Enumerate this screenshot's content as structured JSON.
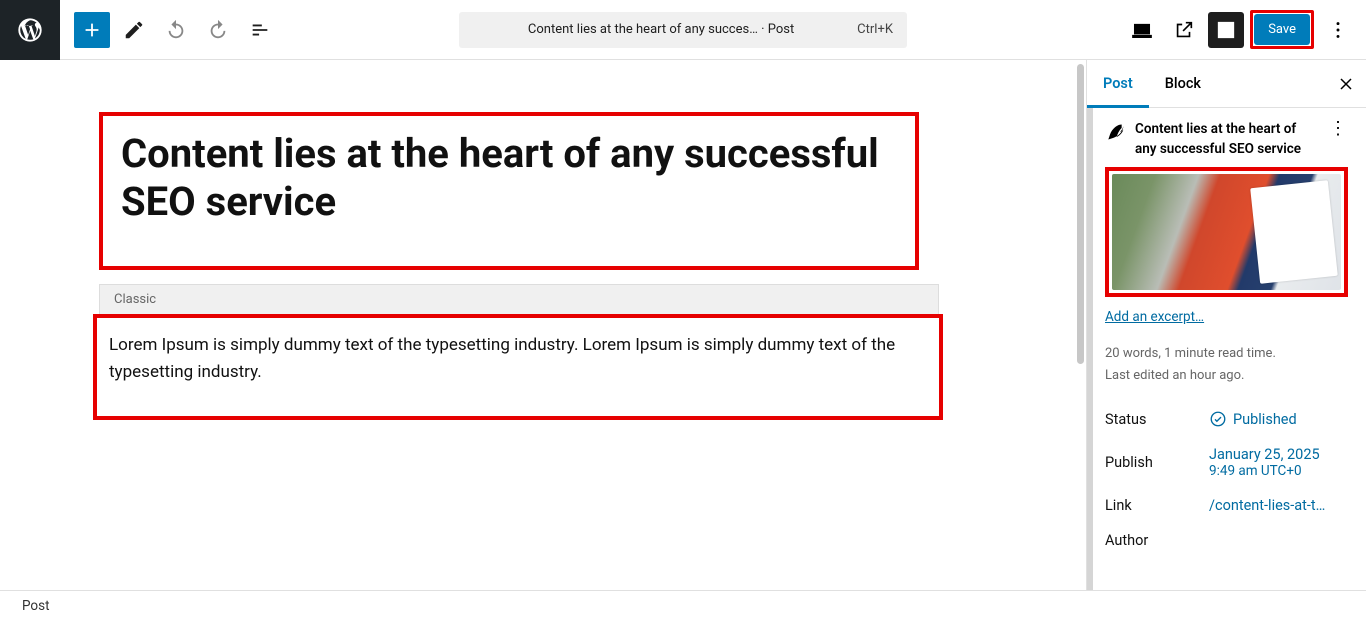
{
  "toolbar": {
    "doc_pill": "Content lies at the heart of any succes… · Post",
    "shortcut": "Ctrl+K",
    "save_label": "Save"
  },
  "editor": {
    "post_title": "Content lies at the heart of any successful SEO service",
    "block_label": "Classic",
    "body_text": "Lorem Ipsum is simply dummy text of the typesetting industry. Lorem Ipsum is simply dummy text of the typesetting industry."
  },
  "sidebar": {
    "tabs": {
      "post": "Post",
      "block": "Block"
    },
    "title": "Content lies at the heart of any successful SEO service",
    "excerpt_link": "Add an excerpt…",
    "stats": "20 words, 1 minute read time.",
    "last_edited": "Last edited an hour ago.",
    "rows": {
      "status_label": "Status",
      "status_value": "Published",
      "publish_label": "Publish",
      "publish_date": "January 25, 2025",
      "publish_time": "9:49 am UTC+0",
      "link_label": "Link",
      "link_value": "/content-lies-at-t…",
      "author_label": "Author"
    }
  },
  "footer": {
    "crumb": "Post"
  }
}
